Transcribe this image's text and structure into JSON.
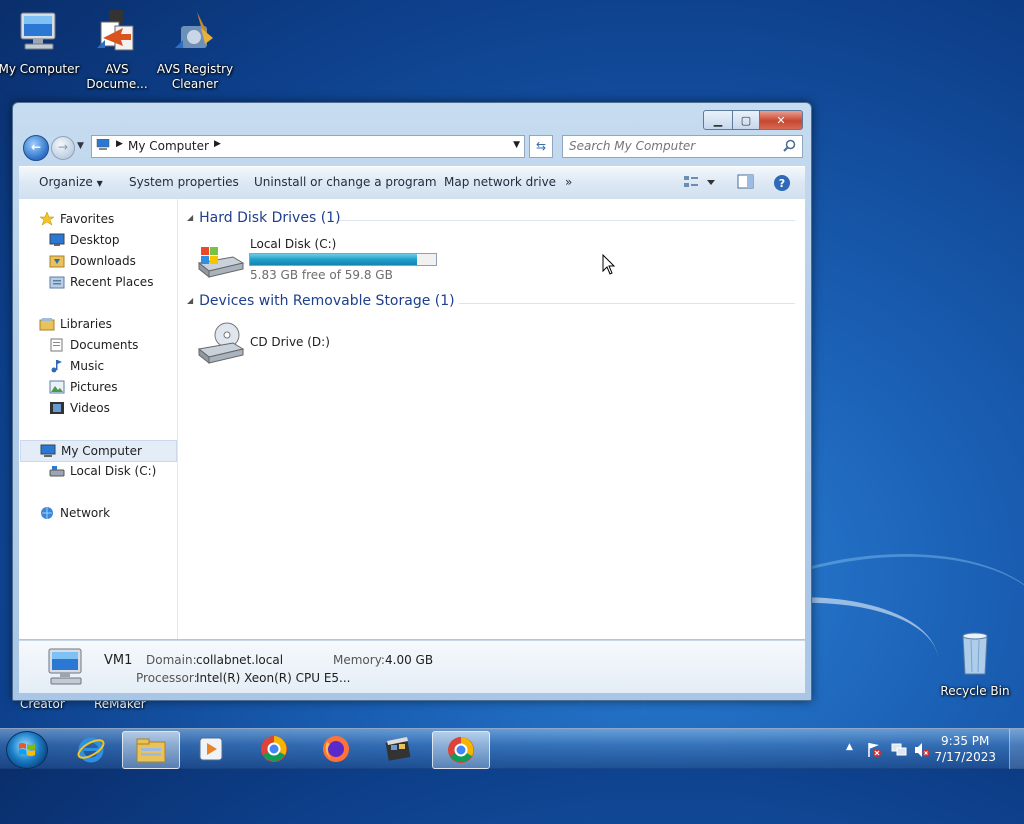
{
  "desktop": {
    "icons": [
      {
        "label": "My Computer",
        "icon": "computer-icon"
      },
      {
        "label": "AVS Docume...",
        "icon": "avs-document-converter-icon"
      },
      {
        "label": "AVS Registry Cleaner",
        "icon": "avs-registry-cleaner-icon"
      },
      {
        "label": "Recycle Bin",
        "icon": "recycle-bin-icon"
      }
    ],
    "partial_labels": [
      "Creator",
      "ReMaker"
    ]
  },
  "window": {
    "address": {
      "crumb": "My Computer"
    },
    "search": {
      "placeholder": "Search My Computer"
    },
    "toolbar": {
      "organize": "Organize",
      "system_properties": "System properties",
      "uninstall": "Uninstall or change a program",
      "map_drive": "Map network drive",
      "more": "»"
    },
    "nav": {
      "favorites": "Favorites",
      "desktop": "Desktop",
      "downloads": "Downloads",
      "recent_places": "Recent Places",
      "libraries": "Libraries",
      "documents": "Documents",
      "music": "Music",
      "pictures": "Pictures",
      "videos": "Videos",
      "my_computer": "My Computer",
      "local_disk": "Local Disk (C:)",
      "network": "Network"
    },
    "groups": {
      "hdd_header": "Hard Disk Drives (1)",
      "removable_header": "Devices with Removable Storage (1)"
    },
    "drives": {
      "c_name": "Local Disk (C:)",
      "c_free": "5.83 GB free of 59.8 GB",
      "c_used_fraction": 0.9,
      "d_name": "CD Drive (D:)"
    },
    "details": {
      "name": "VM1",
      "domain_label": "Domain:",
      "domain": "collabnet.local",
      "memory_label": "Memory:",
      "memory": "4.00 GB",
      "processor_label": "Processor:",
      "processor": "Intel(R) Xeon(R) CPU E5..."
    }
  },
  "taskbar": {
    "time": "9:35 PM",
    "date": "7/17/2023",
    "apps": [
      "internet-explorer-icon",
      "windows-explorer-icon",
      "media-player-icon",
      "chrome-icon",
      "firefox-icon",
      "movie-maker-icon",
      "chrome-icon"
    ]
  }
}
